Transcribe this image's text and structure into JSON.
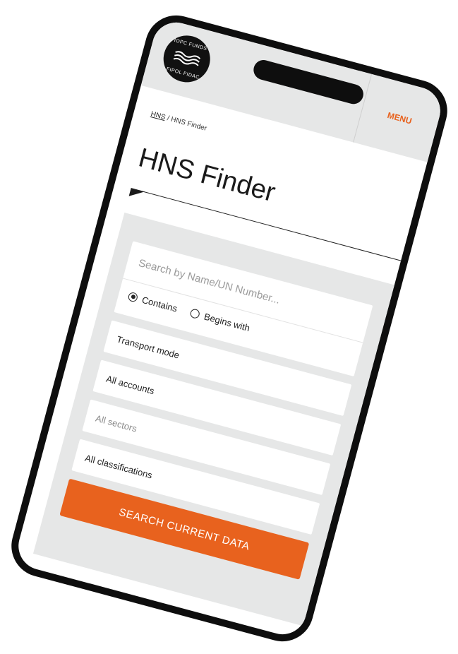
{
  "logo": {
    "top_text": "IOPC FUNDS",
    "bottom_text": "FIPOL FIDAC"
  },
  "header": {
    "menu_label": "MENU"
  },
  "breadcrumb": {
    "home_label": "HNS",
    "separator": "/",
    "current_label": "HNS Finder"
  },
  "page": {
    "title": "HNS Finder"
  },
  "search": {
    "placeholder": "Search by Name/UN Number...",
    "value": "",
    "options": [
      {
        "label": "Contains",
        "selected": true
      },
      {
        "label": "Begins with",
        "selected": false
      }
    ]
  },
  "filters": {
    "transport_mode": "Transport mode",
    "accounts": "All accounts",
    "sectors": "All sectors",
    "classifications": "All classifications"
  },
  "actions": {
    "search_button": "SEARCH CURRENT DATA"
  },
  "colors": {
    "accent": "#e8621e",
    "panel": "#e6e7e7",
    "frame": "#0e0e0e"
  }
}
